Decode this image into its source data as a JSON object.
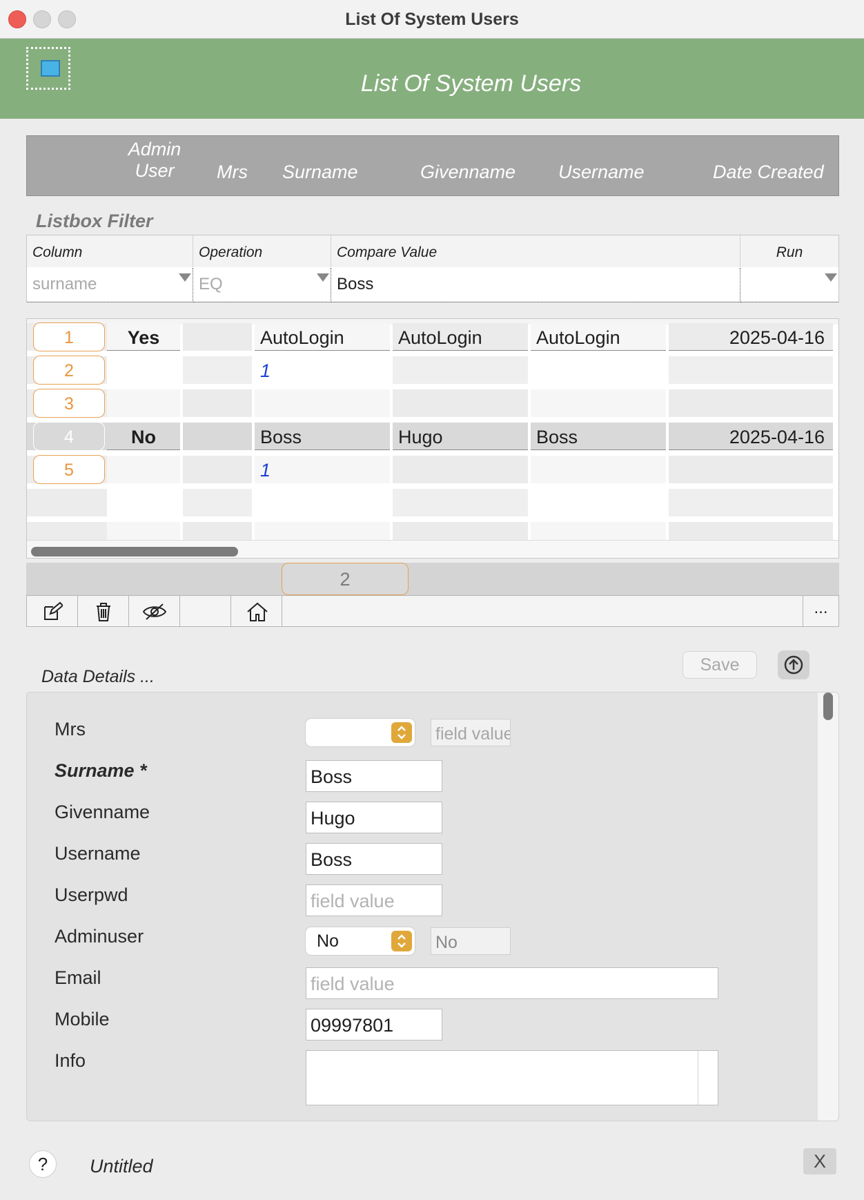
{
  "window": {
    "title": "List Of System Users"
  },
  "header": {
    "title": "List Of System Users"
  },
  "columns": {
    "admin_user_line1": "Admin",
    "admin_user_line2": "User",
    "mrs": "Mrs",
    "surname": "Surname",
    "givenname": "Givenname",
    "username": "Username",
    "date_created": "Date Created"
  },
  "filter": {
    "title": "Listbox Filter",
    "headers": {
      "column": "Column",
      "operation": "Operation",
      "compare": "Compare Value",
      "run": "Run"
    },
    "column_value": "surname",
    "operation_value": "EQ",
    "compare_value": "Boss",
    "run_value": ""
  },
  "rows": [
    {
      "num": "1",
      "admin": "Yes",
      "mrs": "",
      "surname": "AutoLogin",
      "givenname": "AutoLogin",
      "username": "AutoLogin",
      "date": "2025-04-16"
    },
    {
      "num": "2",
      "admin": "",
      "mrs": "",
      "surname": "1",
      "givenname": "",
      "username": "",
      "date": ""
    },
    {
      "num": "3",
      "admin": "",
      "mrs": "",
      "surname": "",
      "givenname": "",
      "username": "",
      "date": ""
    },
    {
      "num": "4",
      "admin": "No",
      "mrs": "",
      "surname": "Boss",
      "givenname": "Hugo",
      "username": "Boss",
      "date": "2025-04-16"
    },
    {
      "num": "5",
      "admin": "",
      "mrs": "",
      "surname": "1",
      "givenname": "",
      "username": "",
      "date": ""
    }
  ],
  "pager": {
    "page": "2"
  },
  "toolbar": {
    "more_label": "..."
  },
  "details": {
    "title": "Data Details ...",
    "save_label": "Save",
    "fields": {
      "mrs": {
        "label": "Mrs",
        "select_value": "",
        "readonly_placeholder": "field value"
      },
      "surname": {
        "label": "Surname *",
        "value": "Boss"
      },
      "givenname": {
        "label": "Givenname",
        "value": "Hugo"
      },
      "username": {
        "label": "Username",
        "value": "Boss"
      },
      "userpwd": {
        "label": "Userpwd",
        "placeholder": "field value"
      },
      "adminuser": {
        "label": "Adminuser",
        "select_value": "No",
        "readonly_value": "No"
      },
      "email": {
        "label": "Email",
        "placeholder": "field value"
      },
      "mobile": {
        "label": "Mobile",
        "value": "09997801"
      },
      "info": {
        "label": "Info",
        "value": ""
      }
    }
  },
  "footer": {
    "help_label": "?",
    "text": "Untitled",
    "close_label": "X"
  },
  "colors": {
    "header_green": "#86af7e",
    "accent_orange": "#e9a054",
    "link_blue": "#1f3fd6"
  },
  "icons": [
    "app-icon",
    "edit-icon",
    "trash-icon",
    "hide-icon",
    "home-icon",
    "upload-icon"
  ]
}
